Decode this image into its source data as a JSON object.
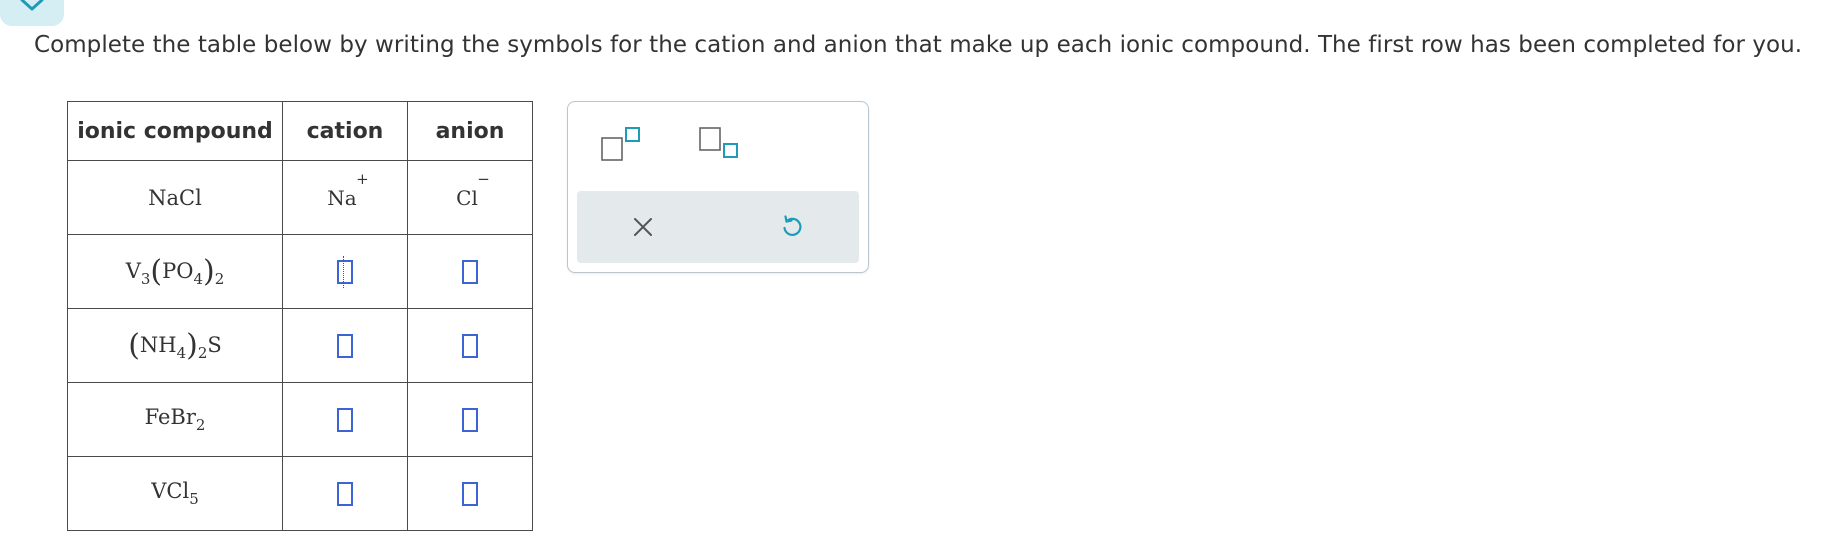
{
  "instructions": "Complete the table below by writing the symbols for the cation and anion that make up each ionic compound. The first row has been completed for you.",
  "table": {
    "headers": [
      "ionic compound",
      "cation",
      "anion"
    ],
    "rows": [
      {
        "compound": {
          "base": "NaCl"
        },
        "cation": {
          "symbol": "Na",
          "charge": "+"
        },
        "anion": {
          "symbol": "Cl",
          "charge": "−"
        }
      },
      {
        "compound": {
          "a": "V",
          "a_sub": "3",
          "b": "PO",
          "b_sub": "4",
          "outer_sub": "2"
        },
        "cation": "empty",
        "anion": "empty"
      },
      {
        "compound": {
          "a": "NH",
          "a_sub": "4",
          "outer_sub": "2",
          "b": "S"
        },
        "cation": "empty",
        "anion": "empty"
      },
      {
        "compound": {
          "a": "FeBr",
          "a_sub": "2"
        },
        "cation": "empty",
        "anion": "empty"
      },
      {
        "compound": {
          "a": "VCl",
          "a_sub": "5"
        },
        "cation": "empty",
        "anion": "empty"
      }
    ]
  },
  "toolbar": {
    "superscript_icon": "superscript-box-icon",
    "subscript_icon": "subscript-box-icon",
    "clear_icon": "x-icon",
    "undo_icon": "undo-icon"
  },
  "colors": {
    "accent": "#1e9bb8",
    "answer_box": "#3e63d4",
    "panel_bg": "#e4e9ec"
  }
}
